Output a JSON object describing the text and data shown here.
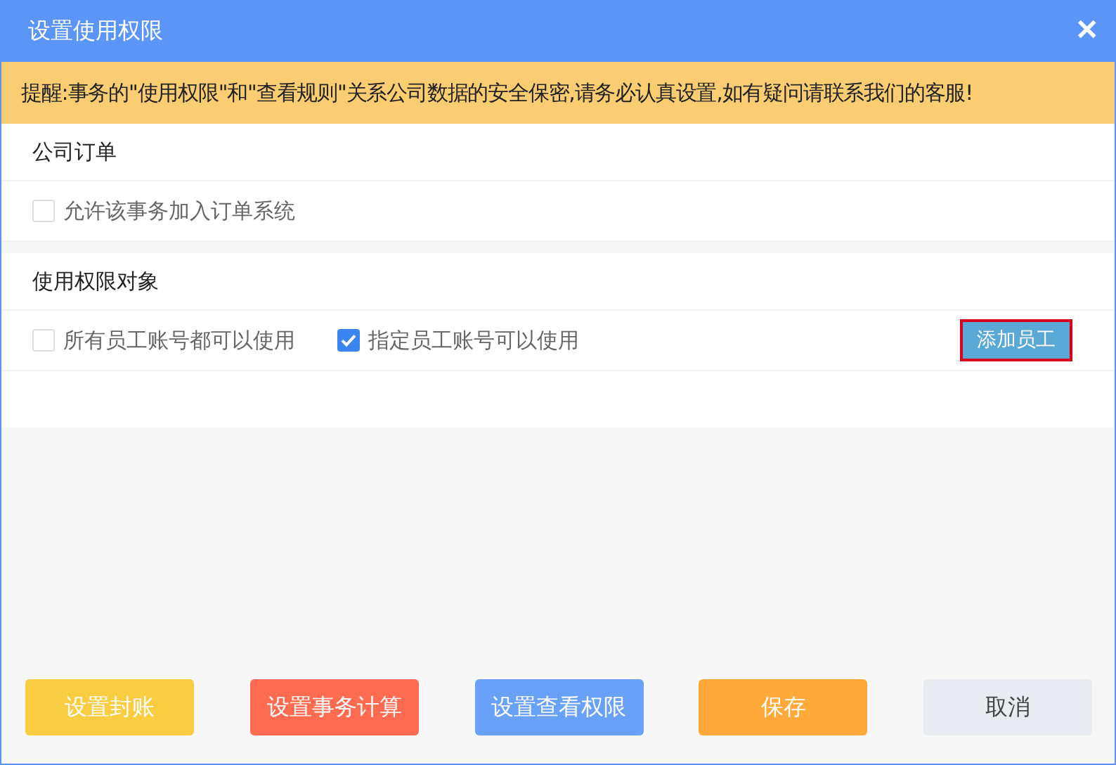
{
  "window": {
    "title": "设置使用权限",
    "close": "✕"
  },
  "notice": "提醒:事务的\"使用权限\"和\"查看规则\"关系公司数据的安全保密,请务必认真设置,如有疑问请联系我们的客服!",
  "sections": [
    {
      "heading": "公司订单",
      "options": [
        {
          "label": "允许该事务加入订单系统",
          "checked": false
        }
      ]
    },
    {
      "heading": "使用权限对象",
      "options": [
        {
          "label": "所有员工账号都可以使用",
          "checked": false
        },
        {
          "label": "指定员工账号可以使用",
          "checked": true
        }
      ],
      "action": "添加员工"
    }
  ],
  "buttons": [
    {
      "label": "设置封账",
      "kind": "yellow"
    },
    {
      "label": "设置事务计算",
      "kind": "red"
    },
    {
      "label": "设置查看权限",
      "kind": "blue"
    },
    {
      "label": "保存",
      "kind": "orange"
    },
    {
      "label": "取消",
      "kind": "plain"
    }
  ]
}
